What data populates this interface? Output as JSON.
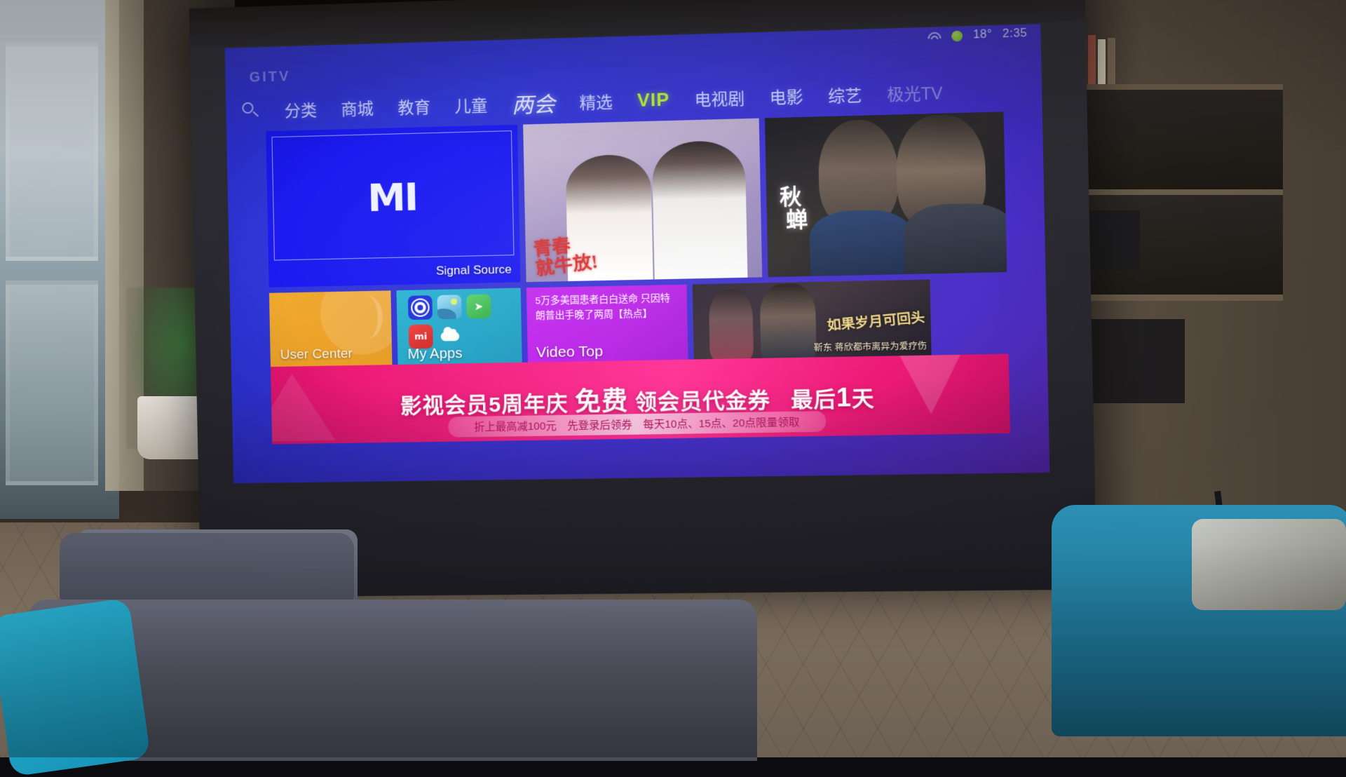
{
  "scene": {
    "description": "living-room-projector-screen",
    "device_ui": "Xiaomi Mi TV home screen (GITV)"
  },
  "statusbar": {
    "wifi_icon": "wifi-icon",
    "indicator_icon": "green-dot-icon",
    "temperature": "18°",
    "time": "2:35"
  },
  "header": {
    "logo": "GITV",
    "search_icon": "search-icon"
  },
  "nav": {
    "items": [
      {
        "label": "分类",
        "style": "normal"
      },
      {
        "label": "商城",
        "style": "normal"
      },
      {
        "label": "教育",
        "style": "normal"
      },
      {
        "label": "儿童",
        "style": "normal"
      },
      {
        "label": "两会",
        "style": "cursive"
      },
      {
        "label": "精选",
        "style": "normal"
      },
      {
        "label": "VIP",
        "style": "vip"
      },
      {
        "label": "电视剧",
        "style": "normal"
      },
      {
        "label": "电影",
        "style": "normal"
      },
      {
        "label": "综艺",
        "style": "normal"
      },
      {
        "label": "极光TV",
        "style": "faded"
      }
    ]
  },
  "tiles": {
    "signal_source": {
      "label": "Signal Source",
      "logo": "MI",
      "bg_color": "#1414f0"
    },
    "poster_drama_1": {
      "calligraphy_line1": "青春",
      "calligraphy_line2": "就牛放!",
      "type": "drama-poster"
    },
    "poster_drama_2": {
      "title": "秋蝉",
      "type": "drama-poster"
    },
    "user_center": {
      "label": "User Center",
      "bg_color": "#f0a828"
    },
    "my_apps": {
      "label": "My Apps",
      "bg_color": "#28b3d2",
      "icons": [
        {
          "name": "settings-icon",
          "glyph": ""
        },
        {
          "name": "gallery-icon",
          "glyph": ""
        },
        {
          "name": "rocket-icon",
          "glyph": "➤"
        },
        {
          "name": "mi-store-icon",
          "glyph": "mi"
        },
        {
          "name": "cloud-icon",
          "glyph": ""
        }
      ]
    },
    "video_top": {
      "label": "Video Top",
      "news_line1": "5万多美国患者白白送命 只因特",
      "news_line2": "朗普出手晚了两周【热点】",
      "bg_color": "#c424f0"
    },
    "promo_drama": {
      "title": "如果岁月可回头",
      "subtitle": "靳东 蒋欣都市离异为爱疗伤"
    }
  },
  "banner": {
    "main_prefix": "影视会员5周年庆",
    "main_highlight": "免费",
    "main_middle": "领会员代金券",
    "main_suffix_label": "最后",
    "main_suffix_number": "1",
    "main_suffix_unit": "天",
    "sub_text": "折上最高减100元　先登录后领券　每天10点、15点、20点限量领取",
    "bg_color": "#f21c7e"
  }
}
